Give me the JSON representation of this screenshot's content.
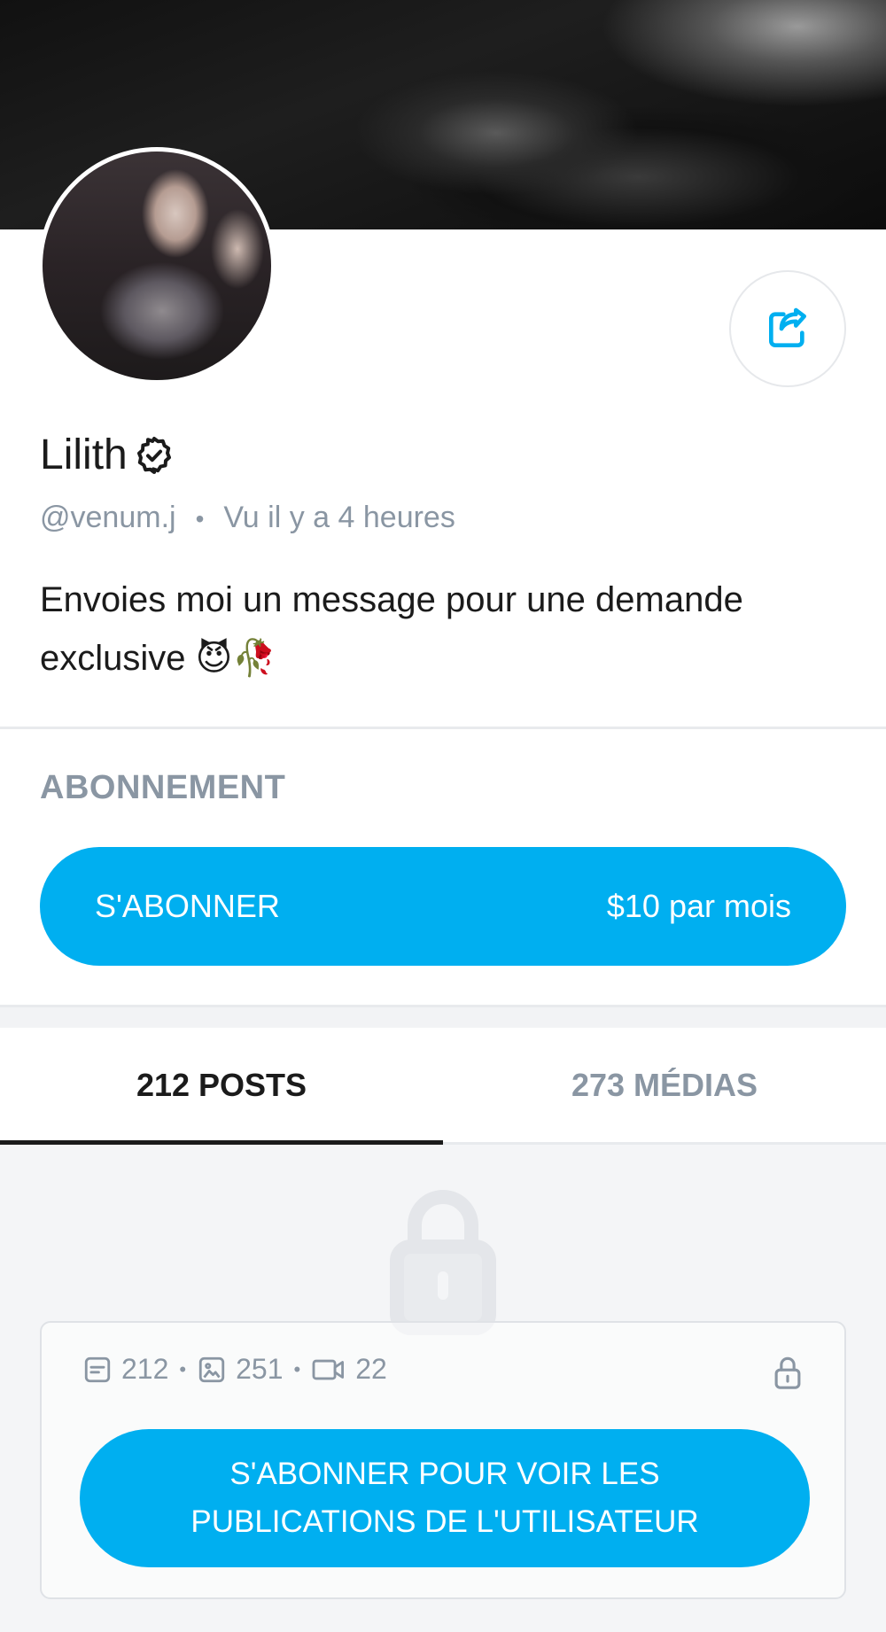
{
  "profile": {
    "name": "Lilith",
    "handle": "@venum.j",
    "last_seen": "Vu  il y a 4 heures",
    "bio": "Envoies moi un message pour une demande exclusive 😈🥀"
  },
  "subscription": {
    "section_title": "ABONNEMENT",
    "button_label": "S'ABONNER",
    "price": "$10 par mois"
  },
  "tabs": [
    {
      "label": "212 POSTS",
      "active": true
    },
    {
      "label": "273 MÉDIAS",
      "active": false
    }
  ],
  "locked": {
    "posts_count": "212",
    "images_count": "251",
    "videos_count": "22",
    "cta_label": "S'ABONNER POUR VOIR LES PUBLICATIONS DE L'UTILISATEUR"
  },
  "colors": {
    "accent": "#00aff0",
    "muted": "#8a96a3",
    "text": "#1b1b1b"
  },
  "icons": [
    "share-icon",
    "verified-badge-icon",
    "lock-icon",
    "post-icon",
    "image-icon",
    "video-icon"
  ]
}
